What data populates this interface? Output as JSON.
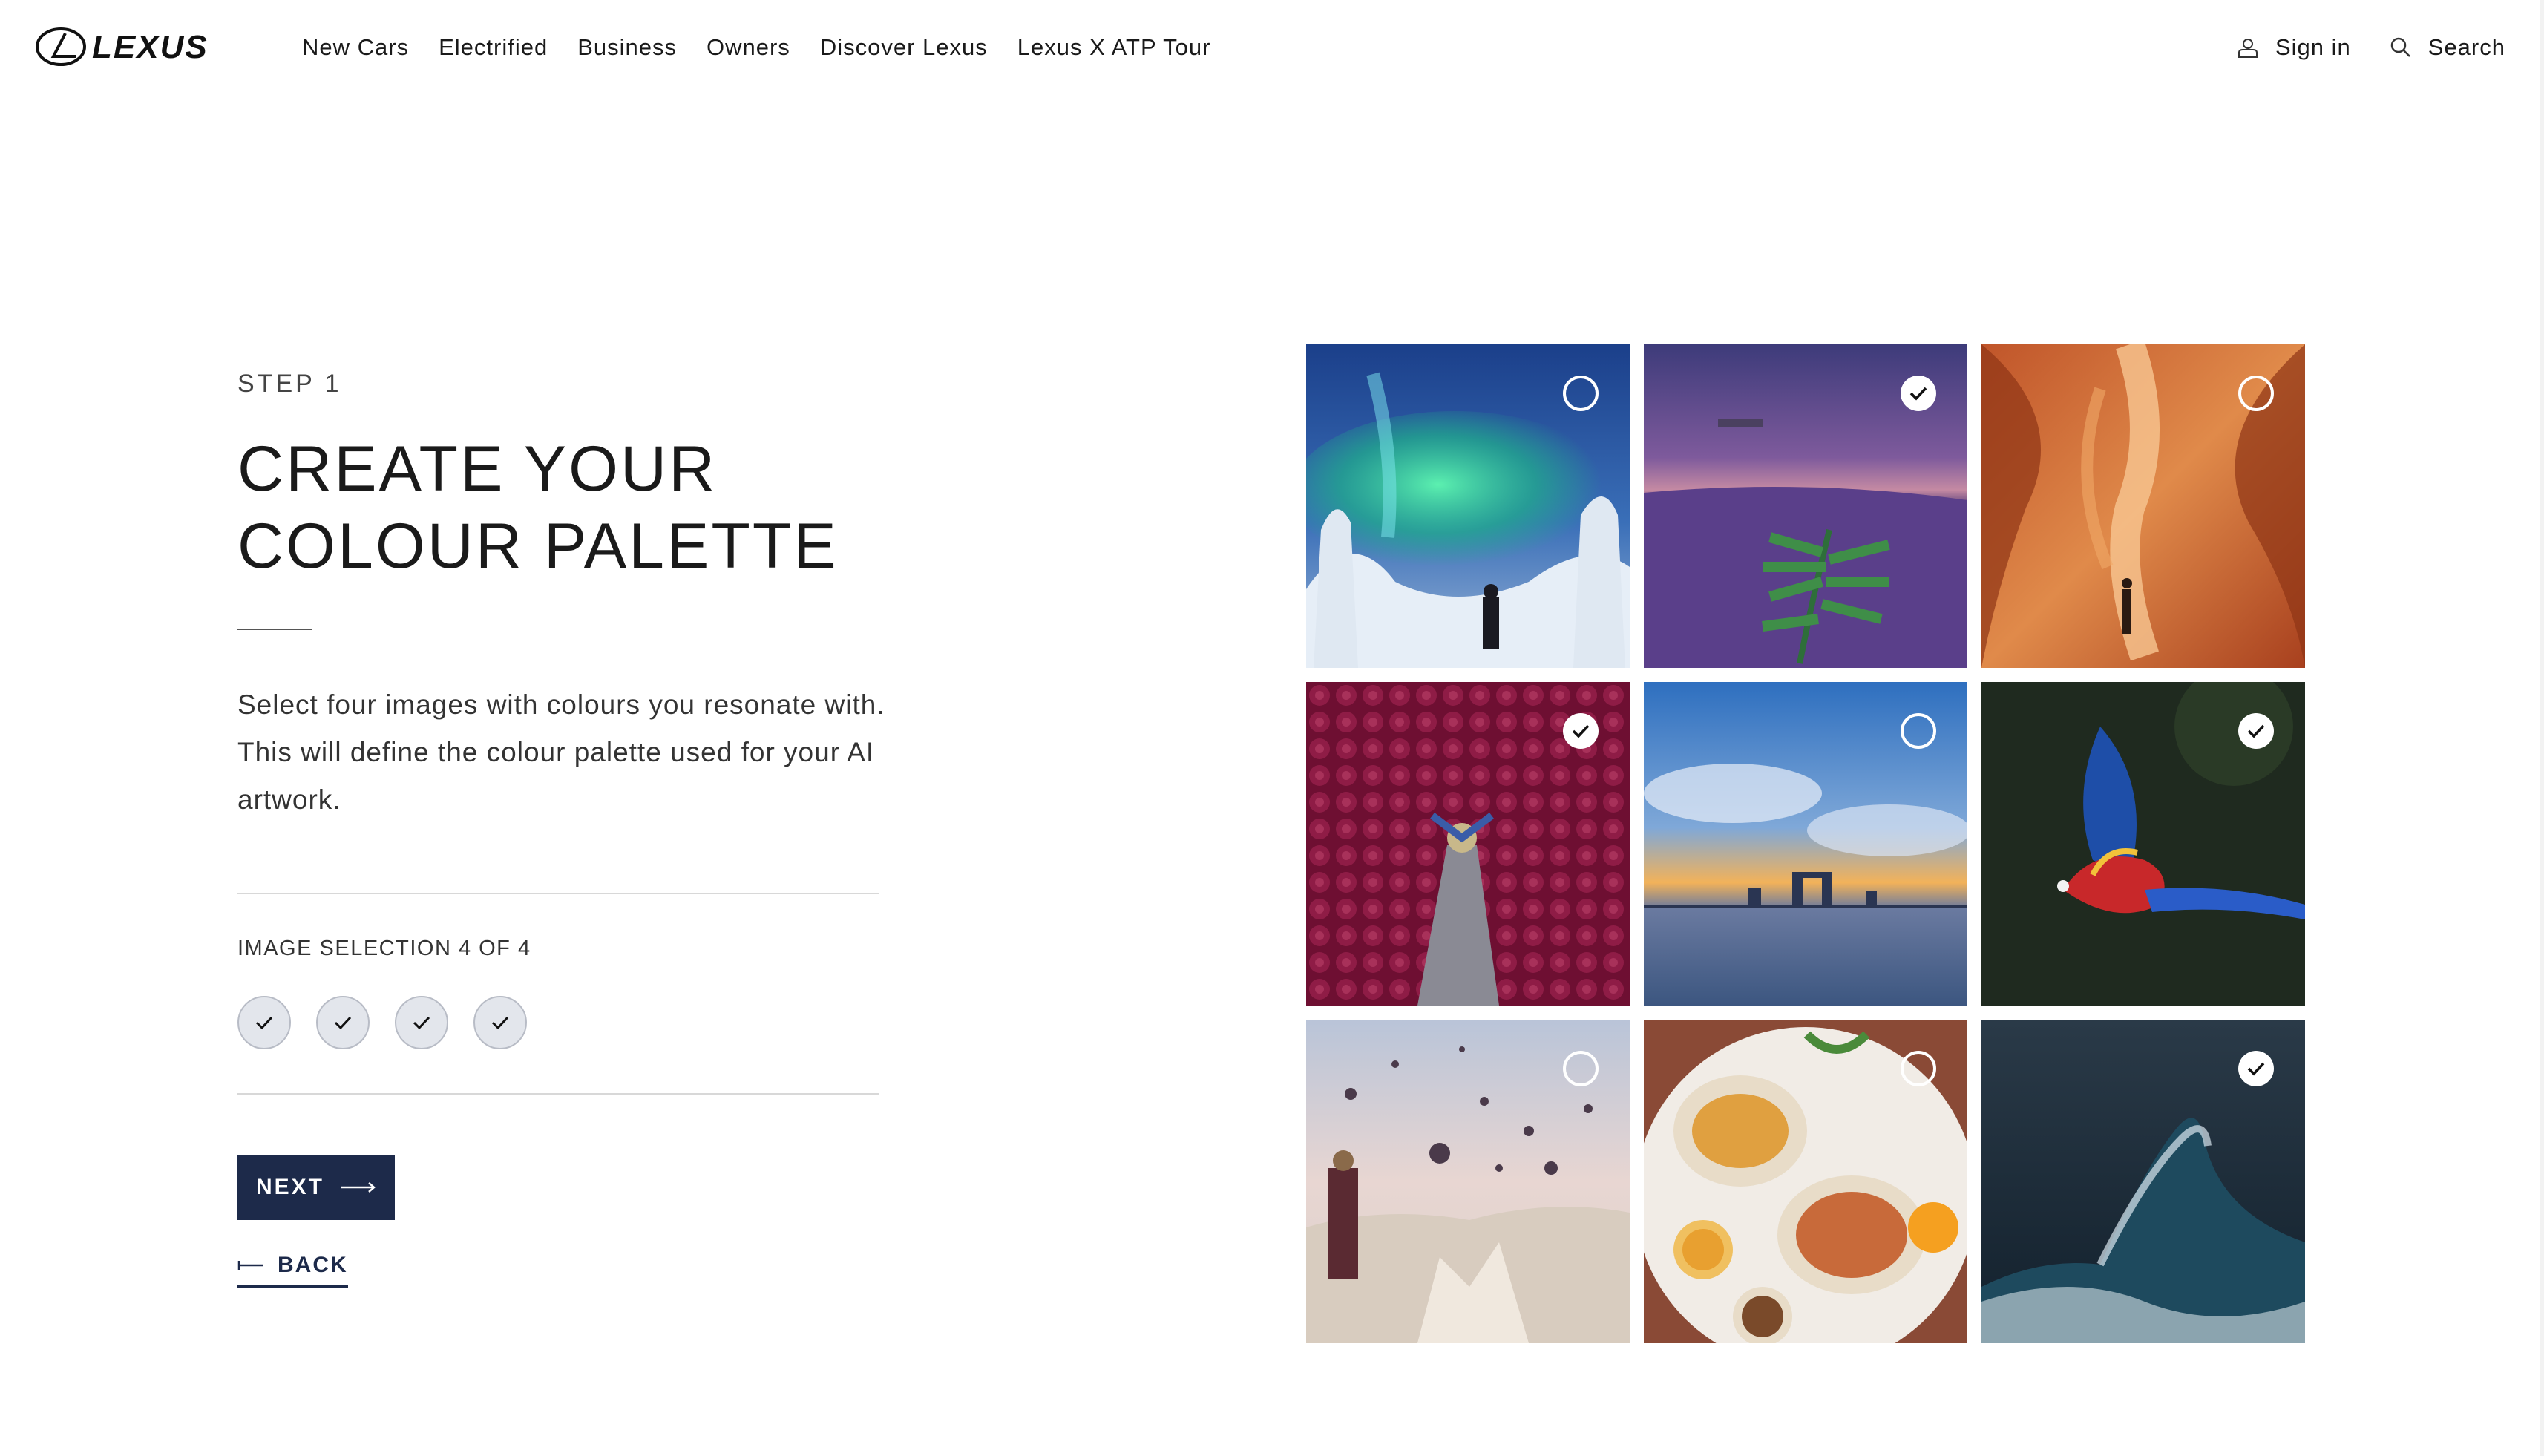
{
  "brand": {
    "name": "LEXUS"
  },
  "nav": {
    "items": [
      "New Cars",
      "Electrified",
      "Business",
      "Owners",
      "Discover Lexus",
      "Lexus X ATP Tour"
    ]
  },
  "utility": {
    "sign_in": "Sign in",
    "search": "Search"
  },
  "content": {
    "step": "STEP 1",
    "title_line1": "CREATE YOUR",
    "title_line2": "COLOUR PALETTE",
    "description": "Select four images with colours you resonate with. This will define the colour palette used for your AI artwork.",
    "selection_label": "IMAGE SELECTION 4 OF 4",
    "selection_slots": [
      {
        "icon": "checkmark-icon",
        "filled": true
      },
      {
        "icon": "checkmark-icon",
        "filled": true
      },
      {
        "icon": "checkmark-icon",
        "filled": true
      },
      {
        "icon": "checkmark-icon",
        "filled": true
      }
    ],
    "next_label": "NEXT",
    "back_label": "BACK"
  },
  "images": [
    {
      "id": "aurora",
      "selected": false
    },
    {
      "id": "heather-fern",
      "selected": true
    },
    {
      "id": "canyon",
      "selected": false
    },
    {
      "id": "magenta-flowers",
      "selected": true
    },
    {
      "id": "city-sunset",
      "selected": false
    },
    {
      "id": "macaw",
      "selected": true
    },
    {
      "id": "balloons",
      "selected": false
    },
    {
      "id": "food-table",
      "selected": false
    },
    {
      "id": "wave",
      "selected": true
    }
  ],
  "colors": {
    "accent": "#1d2a4a",
    "slot_fill": "#e3e6ec"
  }
}
